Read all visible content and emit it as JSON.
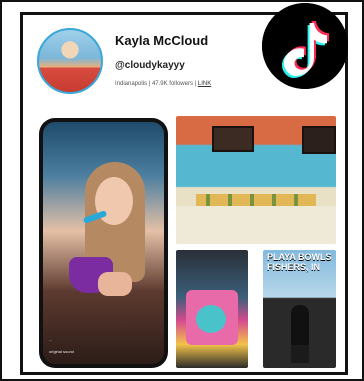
{
  "profile": {
    "name": "Kayla McCloud",
    "handle": "@cloudykayyy",
    "location": "Indianapolis",
    "followers": "47.9K followers",
    "link_label": "LINK"
  },
  "phone_post": {
    "caption": "...",
    "sound": "original sound"
  },
  "tiles": {
    "sign_text": "PLAYA BOWLS\nFISHERS, IN"
  },
  "branding": {
    "logo_icon": "tiktok-logo-icon",
    "colors": {
      "tiktok_black": "#000000",
      "tiktok_cyan": "#25F4EE",
      "tiktok_red": "#FE2C55"
    }
  }
}
